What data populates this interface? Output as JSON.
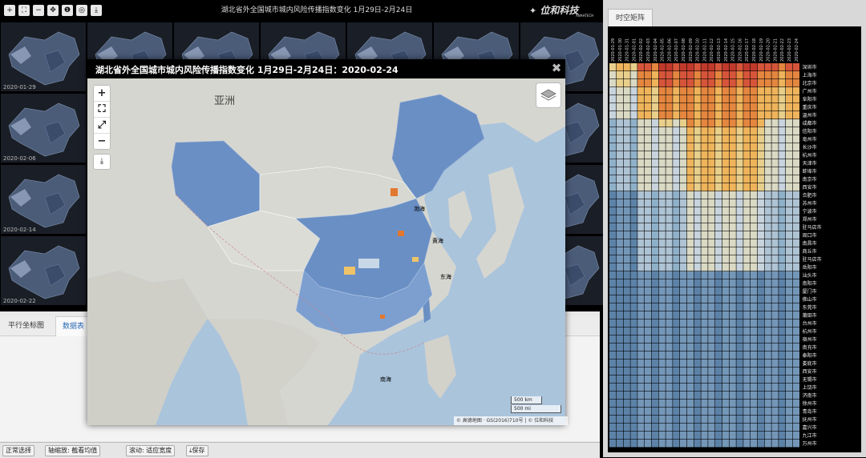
{
  "toolbar": {
    "buttons": [
      "+",
      "⛶",
      "−",
      "✥",
      "❶",
      "◎",
      "⤓"
    ],
    "title": "湖北省外全国城市城内风险传播指数变化 1月29日-2月24日",
    "logo_text": "位和科技",
    "logo_sub": "ANAHTECH"
  },
  "thumbs": {
    "labels": [
      "2020-01-29",
      "2020-02-06",
      "2020-02-14",
      "2020-02-22"
    ]
  },
  "left_tabs": {
    "parallel": "平行坐标图",
    "table": "数据表"
  },
  "bottom_controls": {
    "select_mode": "正常选择",
    "axis_zoom": "轴缩放: 截看均值",
    "scroll": "滚动: 适应宽度",
    "save": "保存"
  },
  "right_panel": {
    "tab": "时空矩阵",
    "dates": [
      "2020-01-29",
      "2020-01-30",
      "2020-01-31",
      "2020-02-01",
      "2020-02-02",
      "2020-02-03",
      "2020-02-04",
      "2020-02-05",
      "2020-02-06",
      "2020-02-07",
      "2020-02-08",
      "2020-02-09",
      "2020-02-10",
      "2020-02-11",
      "2020-02-12",
      "2020-02-13",
      "2020-02-14",
      "2020-02-15",
      "2020-02-16",
      "2020-02-17",
      "2020-02-18",
      "2020-02-19",
      "2020-02-20",
      "2020-02-21",
      "2020-02-22",
      "2020-02-23",
      "2020-02-24"
    ],
    "cities": [
      "深圳市",
      "上海市",
      "北京市",
      "广州市",
      "阜阳市",
      "重庆市",
      "温州市",
      "成都市",
      "信阳市",
      "亳州市",
      "长沙市",
      "杭州市",
      "天津市",
      "蚌埠市",
      "南京市",
      "西安市",
      "合肥市",
      "苏州市",
      "宁波市",
      "郑州市",
      "驻马店市",
      "周口市",
      "南昌市",
      "商丘市",
      "驻马店市",
      "岳阳市",
      "汕头市",
      "南阳市",
      "厦门市",
      "佛山市",
      "东莞市",
      "莆田市",
      "台州市",
      "杭州市",
      "宿州市",
      "南充市",
      "泰阳市",
      "娄底市",
      "西安市",
      "无锡市",
      "上饶市",
      "济南市",
      "徐州市",
      "青岛市",
      "抚州市",
      "嘉兴市",
      "九江市",
      "万州市"
    ]
  },
  "modal": {
    "title": "湖北省外全国城市城内风险传播指数变化 1月29日-2月24日：2020-02-24",
    "close": "✖",
    "zoom_in": "+",
    "fullscreen": "⛶",
    "expand": "⤢",
    "zoom_out": "−",
    "download": "⤓",
    "continent": "亚洲",
    "sea_labels": {
      "bohai": "渤海",
      "huanghai": "黄海",
      "donghai": "东海",
      "nanhai": "南海"
    },
    "scale_km": "500 km",
    "scale_mi": "500 mi",
    "attribution": "© 高德地图 · GS(2016)710号 | © 位和科技"
  },
  "colors": {
    "province_fill": "#6a8fc4",
    "high_risk": "#e2782f",
    "medium_risk": "#f0c368",
    "low_risk": "#c8d8e6",
    "sea": "#aac4dc"
  }
}
